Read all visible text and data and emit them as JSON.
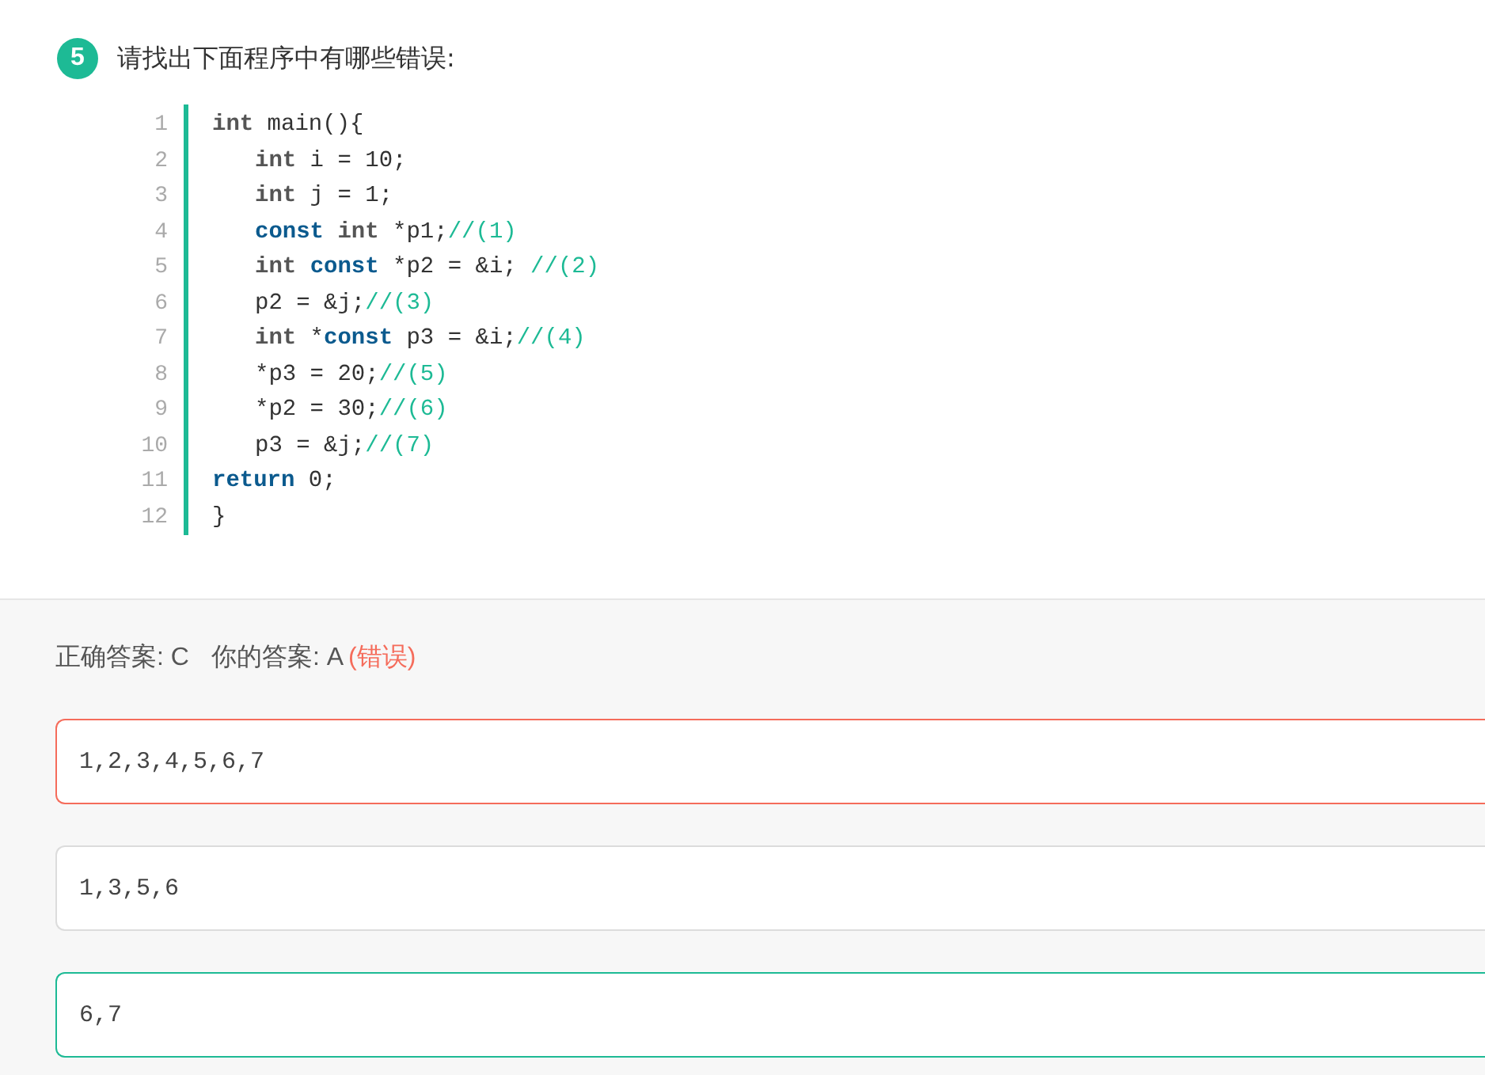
{
  "question": {
    "number": "5",
    "text": "请找出下面程序中有哪些错误:"
  },
  "code": [
    {
      "line": "1",
      "indent": false,
      "tokens": [
        {
          "kind": "type",
          "text": "int"
        },
        {
          "kind": "plain",
          "text": " main(){"
        }
      ]
    },
    {
      "line": "2",
      "indent": true,
      "tokens": [
        {
          "kind": "type",
          "text": "int"
        },
        {
          "kind": "plain",
          "text": " i = 10;"
        }
      ]
    },
    {
      "line": "3",
      "indent": true,
      "tokens": [
        {
          "kind": "type",
          "text": "int"
        },
        {
          "kind": "plain",
          "text": " j = 1;"
        }
      ]
    },
    {
      "line": "4",
      "indent": true,
      "tokens": [
        {
          "kind": "keyword",
          "text": "const "
        },
        {
          "kind": "type",
          "text": "int"
        },
        {
          "kind": "plain",
          "text": " *p1;"
        },
        {
          "kind": "comment",
          "text": "//(1)"
        }
      ]
    },
    {
      "line": "5",
      "indent": true,
      "tokens": [
        {
          "kind": "type",
          "text": "int "
        },
        {
          "kind": "keyword",
          "text": "const"
        },
        {
          "kind": "plain",
          "text": " *p2 = &i; "
        },
        {
          "kind": "comment",
          "text": "//(2)"
        }
      ]
    },
    {
      "line": "6",
      "indent": true,
      "tokens": [
        {
          "kind": "plain",
          "text": "p2 = &j;"
        },
        {
          "kind": "comment",
          "text": "//(3)"
        }
      ]
    },
    {
      "line": "7",
      "indent": true,
      "tokens": [
        {
          "kind": "type",
          "text": "int"
        },
        {
          "kind": "plain",
          "text": " *"
        },
        {
          "kind": "keyword",
          "text": "const"
        },
        {
          "kind": "plain",
          "text": " p3 = &i;"
        },
        {
          "kind": "comment",
          "text": "//(4)"
        }
      ]
    },
    {
      "line": "8",
      "indent": true,
      "tokens": [
        {
          "kind": "plain",
          "text": "*p3 = 20;"
        },
        {
          "kind": "comment",
          "text": "//(5)"
        }
      ]
    },
    {
      "line": "9",
      "indent": true,
      "tokens": [
        {
          "kind": "plain",
          "text": "*p2 = 30;"
        },
        {
          "kind": "comment",
          "text": "//(6)"
        }
      ]
    },
    {
      "line": "10",
      "indent": true,
      "tokens": [
        {
          "kind": "plain",
          "text": "p3 = &j;"
        },
        {
          "kind": "comment",
          "text": "//(7)"
        }
      ]
    },
    {
      "line": "11",
      "indent": false,
      "tokens": [
        {
          "kind": "keyword",
          "text": "return"
        },
        {
          "kind": "plain",
          "text": " 0;"
        }
      ]
    },
    {
      "line": "12",
      "indent": false,
      "tokens": [
        {
          "kind": "plain",
          "text": "}"
        }
      ]
    }
  ],
  "result": {
    "correct_label": "正确答案: C",
    "your_label": "你的答案: A",
    "verdict": "(错误)"
  },
  "options": [
    {
      "text": "1,2,3,4,5,6,7",
      "selected": true,
      "correct": false
    },
    {
      "text": "1,3,5,6",
      "selected": false,
      "correct": false
    },
    {
      "text": "6,7",
      "selected": false,
      "correct": true
    }
  ]
}
